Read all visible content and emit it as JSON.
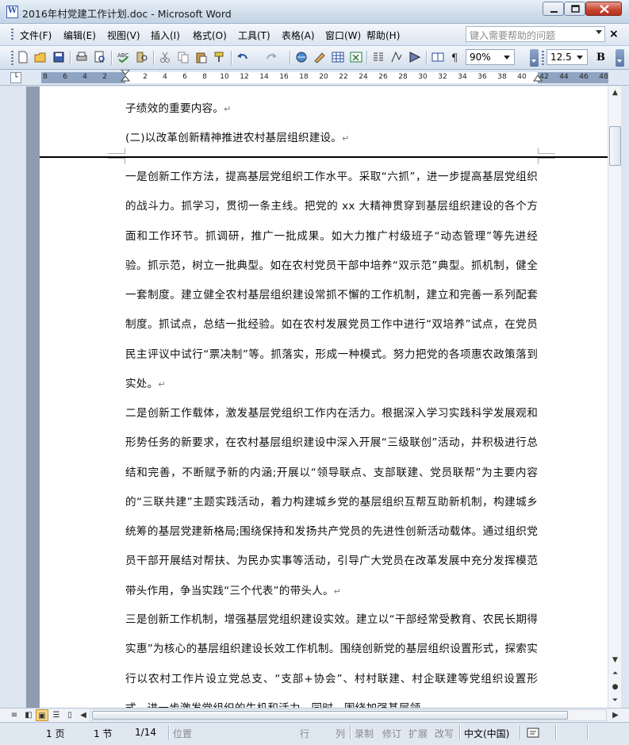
{
  "window": {
    "title": "2016年村党建工作计划.doc - Microsoft Word"
  },
  "menu": {
    "items": [
      "文件(F)",
      "编辑(E)",
      "视图(V)",
      "插入(I)",
      "格式(O)",
      "工具(T)",
      "表格(A)",
      "窗口(W)",
      "帮助(H)"
    ],
    "help_placeholder": "键入需要帮助的问题"
  },
  "toolbar": {
    "zoom": "90%",
    "font_size": "12.5",
    "bold_label": "B"
  },
  "ruler": {
    "labels": [
      "8",
      "6",
      "4",
      "2",
      "2",
      "4",
      "6",
      "8",
      "10",
      "12",
      "14",
      "16",
      "18",
      "20",
      "22",
      "24",
      "26",
      "28",
      "30",
      "32",
      "34",
      "36",
      "38",
      "40",
      "42",
      "44",
      "46",
      "48"
    ]
  },
  "document": {
    "paragraphs": [
      "子绩效的重要内容。",
      "(二)以改革创新精神推进农村基层组织建设。",
      "一是创新工作方法，提高基层党组织工作水平。采取“六抓”，进一步提高基层党组织的战斗力。抓学习，贯彻一条主线。把党的 xx 大精神贯穿到基层组织建设的各个方面和工作环节。抓调研，推广一批成果。如大力推广村级班子“动态管理”等先进经验。抓示范，树立一批典型。如在农村党员干部中培养“双示范”典型。抓机制，健全一套制度。建立健全农村基层组织建设常抓不懈的工作机制，建立和完善一系列配套制度。抓试点，总结一批经验。如在农村发展党员工作中进行“双培养”试点，在党员民主评议中试行“票决制”等。抓落实，形成一种模式。努力把党的各项惠农政策落到实处。",
      "二是创新工作载体，激发基层党组织工作内在活力。根据深入学习实践科学发展观和形势任务的新要求，在农村基层组织建设中深入开展“三级联创”活动，并积极进行总结和完善，不断赋予新的内涵;开展以“领导联点、支部联建、党员联帮”为主要内容的“三联共建”主题实践活动，着力构建城乡党的基层组织互帮互助新机制，构建城乡统筹的基层党建新格局;围绕保持和发扬共产党员的先进性创新活动载体。通过组织党员干部开展结对帮扶、为民办实事等活动，引导广大党员在改革发展中充分发挥模范带头作用，争当实践“三个代表”的带头人。",
      "三是创新工作机制，增强基层党组织建设实效。建立以“干部经常受教育、农民长期得实惠”为核心的基层组织建设长效工作机制。围绕创新党的基层组织设置形式，探索实行以农村工作片设立党总支、“支部+协会”、村村联建、村企联建等党组织设置形式，进一步激发党组织的生机和活力。同时，围绕加强基层领"
    ],
    "para_mark": "↵"
  },
  "status": {
    "page": "1 页",
    "section": "1 节",
    "page_of": "1/14",
    "position": "位置",
    "line": "行",
    "col": "列",
    "rec": "录制",
    "trk": "修订",
    "ext": "扩展",
    "ovr": "改写",
    "language": "中文(中国)"
  }
}
